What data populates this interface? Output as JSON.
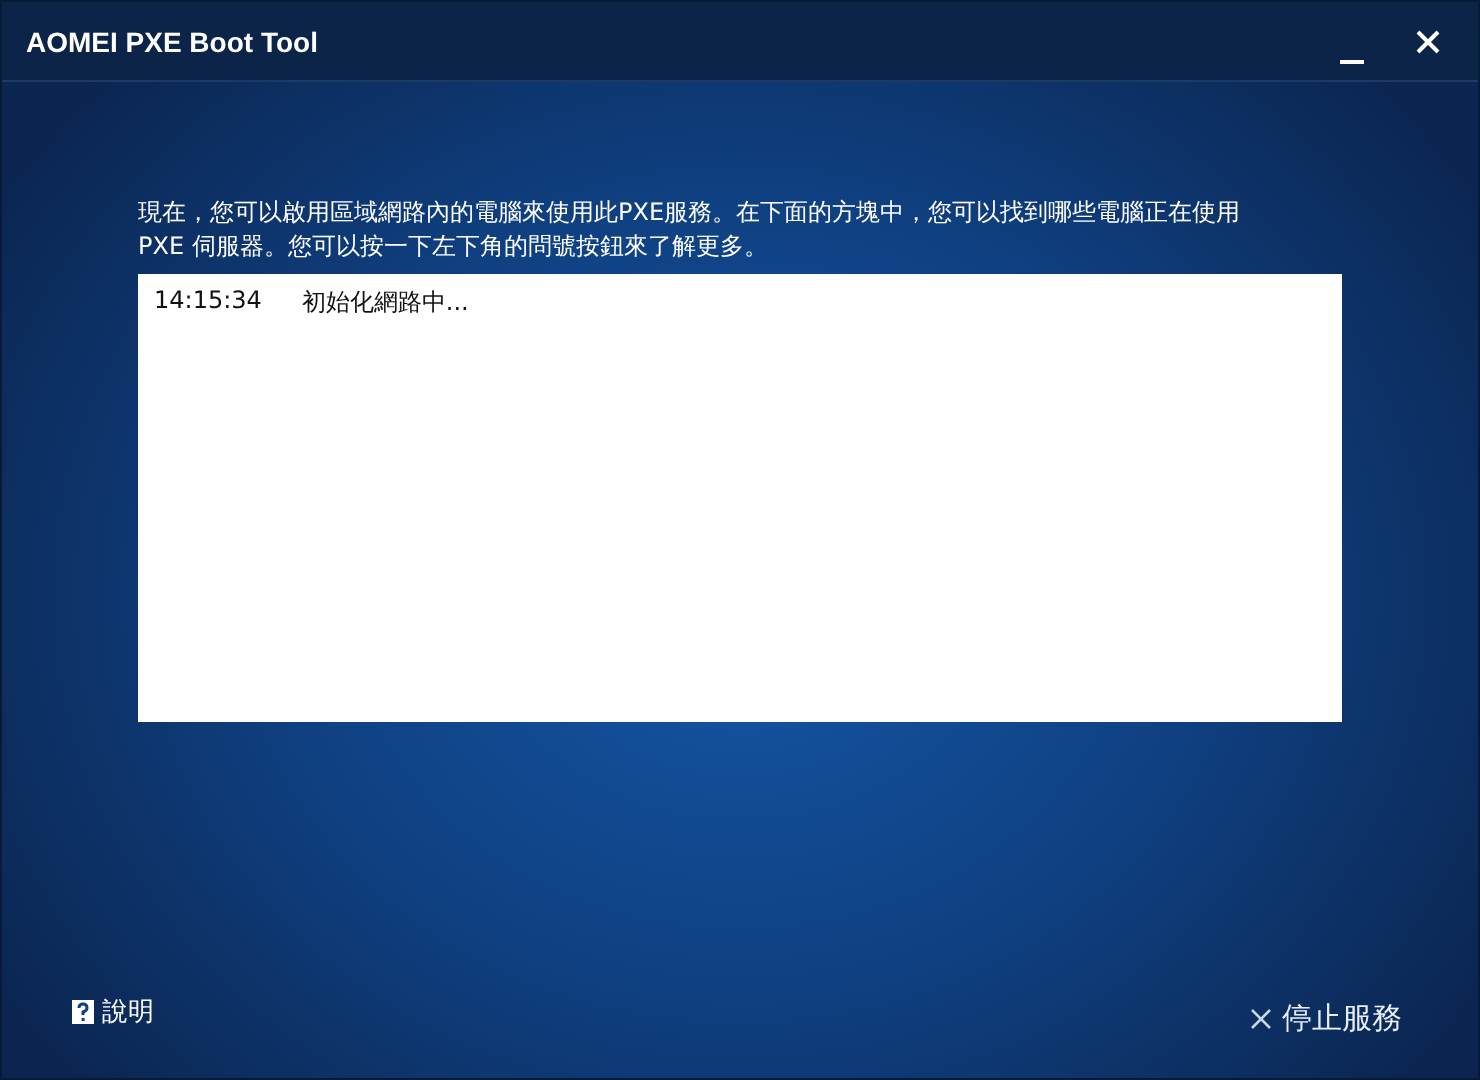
{
  "window": {
    "title": "AOMEI PXE Boot Tool"
  },
  "intro": "現在，您可以啟用區域網路內的電腦來使用此PXE服務。在下面的方塊中，您可以找到哪些電腦正在使用PXE 伺服器。您可以按一下左下角的問號按鈕來了解更多。",
  "log": [
    {
      "time": "14:15:34",
      "message": "初始化網路中..."
    }
  ],
  "help": {
    "label": "說明"
  },
  "stop": {
    "label": "停止服務"
  }
}
